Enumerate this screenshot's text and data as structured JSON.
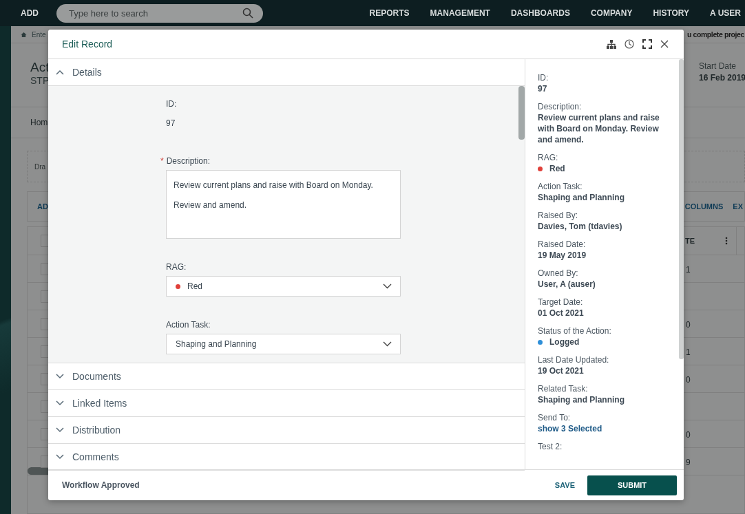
{
  "nav": {
    "add": "ADD",
    "search_placeholder": "Type here to search",
    "items": [
      "REPORTS",
      "MANAGEMENT",
      "DASHBOARDS",
      "COMPANY",
      "HISTORY",
      "A USER"
    ]
  },
  "breadcrumb": {
    "home": "Ente",
    "banner": "u complete projec"
  },
  "page": {
    "title": "Act",
    "subtitle": "STP",
    "start_date_label": "Start Date",
    "start_date": "16 Feb 2019",
    "tab": "Hom",
    "drop_zone": "Dra",
    "toolbar": {
      "add": "AD",
      "columns": "COLUMNS",
      "export": "EX"
    },
    "table": {
      "column_header": "TE",
      "header_checked": false,
      "rows": [
        {
          "checked": false,
          "cell": "1"
        },
        {
          "checked": false,
          "cell": ""
        },
        {
          "checked": false,
          "cell": "0"
        },
        {
          "checked": false,
          "cell": "1"
        },
        {
          "checked": false,
          "cell": "0"
        },
        {
          "checked": false,
          "cell": ""
        },
        {
          "checked": false,
          "cell": "0"
        },
        {
          "checked": false,
          "cell": "9"
        }
      ]
    }
  },
  "modal": {
    "title": "Edit Record",
    "sections": [
      {
        "label": "Details",
        "expanded": true
      },
      {
        "label": "Documents",
        "expanded": false
      },
      {
        "label": "Linked Items",
        "expanded": false
      },
      {
        "label": "Distribution",
        "expanded": false
      },
      {
        "label": "Comments",
        "expanded": false
      }
    ],
    "fields": [
      {
        "kind": "readonly",
        "label": "ID:",
        "value": "97"
      },
      {
        "kind": "textarea",
        "label": "Description:",
        "required_mark": "*",
        "paragraphs": [
          "Review current plans and raise with Board on Monday.",
          "Review and amend."
        ]
      },
      {
        "kind": "select",
        "label": "RAG:",
        "value": "Red",
        "color": "#e0403a"
      },
      {
        "kind": "select",
        "label": "Action Task:",
        "value": "Shaping and Planning"
      }
    ],
    "summary": [
      {
        "label": "ID:",
        "value": "97"
      },
      {
        "label": "Description:",
        "value": "Review current plans and raise with Board on Monday. Review and amend."
      },
      {
        "label": "RAG:",
        "value": "Red",
        "color": "#e0403a"
      },
      {
        "label": "Action Task:",
        "value": "Shaping and Planning"
      },
      {
        "label": "Raised By:",
        "value": "Davies, Tom (tdavies)"
      },
      {
        "label": "Raised Date:",
        "value": "19 May 2019"
      },
      {
        "label": "Owned By:",
        "value": "User, A (auser)"
      },
      {
        "label": "Target Date:",
        "value": "01 Oct 2021"
      },
      {
        "label": "Status of the Action:",
        "value": "Logged",
        "color": "#2f8fd8"
      },
      {
        "label": "Last Date Updated:",
        "value": "19 Oct 2021"
      },
      {
        "label": "Related Task:",
        "value": "Shaping and Planning"
      },
      {
        "label": "Send To:",
        "value": "show 3 Selected",
        "kind": "link"
      },
      {
        "label": "Test 2:"
      }
    ],
    "footer": {
      "status": "Workflow Approved",
      "save": "SAVE",
      "submit": "SUBMIT"
    }
  }
}
